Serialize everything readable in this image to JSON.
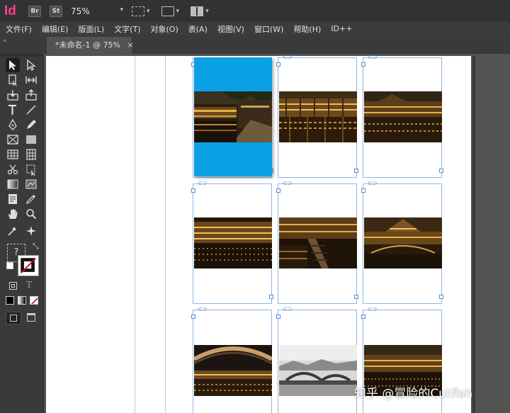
{
  "app": {
    "logo": "Id",
    "bridge_label": "Br",
    "stock_label": "St",
    "zoom": "75%"
  },
  "menu": [
    "文件(F)",
    "编辑(E)",
    "版面(L)",
    "文字(T)",
    "对象(O)",
    "表(A)",
    "视图(V)",
    "窗口(W)",
    "帮助(H)",
    "ID++"
  ],
  "document_tab": {
    "title": "*未命名-1 @ 75%",
    "close": "×"
  },
  "tools": {
    "question_mark": "?"
  },
  "watermark": "知乎 @冒险的Cutfish",
  "colors": {
    "selection_fill": "#0aa0e6",
    "frame_edge": "#8fb6e0",
    "logo": "#ff3f94"
  }
}
